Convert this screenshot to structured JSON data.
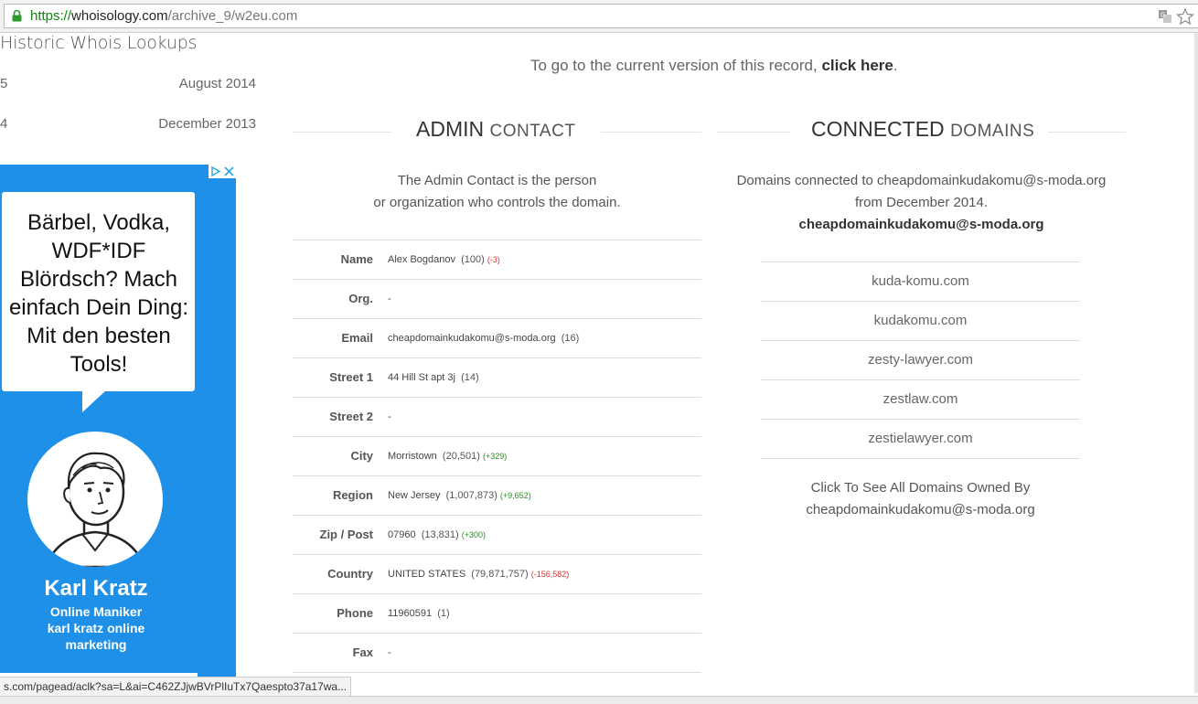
{
  "browser": {
    "url_scheme": "https://",
    "url_host": "whoisology.com",
    "url_path": "/archive_9/w2eu.com",
    "status_url": "s.com/pagead/aclk?sa=L&ai=C462ZJjwBVrPlIuTx7Qaespto37a17wa..."
  },
  "sidebar": {
    "title": "Historic Whois Lookups",
    "history": [
      {
        "num": "5",
        "date": "August 2014"
      },
      {
        "num": "4",
        "date": "December 2013"
      }
    ]
  },
  "ad": {
    "bubble_text": "Bärbel, Vodka, WDF*IDF Blördsch? Mach einfach Dein Ding: Mit den besten Tools!",
    "name": "Karl Kratz",
    "sub1": "Online Maniker",
    "sub2": "karl kratz online marketing",
    "bg_color": "#1e90e8"
  },
  "main": {
    "current_text": "To go to the current version of this record, ",
    "current_link": "click here",
    "current_tail": ".",
    "admin": {
      "title_bold": "ADMIN",
      "title_light": "CONTACT",
      "desc_line1": "The Admin Contact is the person",
      "desc_line2": "or organization who controls the domain.",
      "rows": [
        {
          "label": "Name",
          "value": "Alex Bogdanov",
          "count": "(100)",
          "delta": "(-3)",
          "delta_type": "neg"
        },
        {
          "label": "Org.",
          "value": "-",
          "count": "",
          "delta": "",
          "delta_type": ""
        },
        {
          "label": "Email",
          "value": "cheapdomainkudakomu@s-moda.org",
          "count": "(16)",
          "delta": "",
          "delta_type": ""
        },
        {
          "label": "Street 1",
          "value": "44 Hill St apt 3j",
          "count": "(14)",
          "delta": "",
          "delta_type": ""
        },
        {
          "label": "Street 2",
          "value": "-",
          "count": "",
          "delta": "",
          "delta_type": ""
        },
        {
          "label": "City",
          "value": "Morristown",
          "count": "(20,501)",
          "delta": "(+329)",
          "delta_type": "pos"
        },
        {
          "label": "Region",
          "value": "New Jersey",
          "count": "(1,007,873)",
          "delta": "(+9,652)",
          "delta_type": "pos"
        },
        {
          "label": "Zip / Post",
          "value": "07960",
          "count": "(13,831)",
          "delta": "(+300)",
          "delta_type": "pos"
        },
        {
          "label": "Country",
          "value": "UNITED STATES",
          "count": "(79,871,757)",
          "delta": "(-156,582)",
          "delta_type": "neg"
        },
        {
          "label": "Phone",
          "value": "11960591",
          "count": "(1)",
          "delta": "",
          "delta_type": ""
        },
        {
          "label": "Fax",
          "value": "-",
          "count": "",
          "delta": "",
          "delta_type": ""
        }
      ]
    },
    "connected": {
      "title_bold": "CONNECTED",
      "title_light": "DOMAINS",
      "desc_line1": "Domains connected to cheapdomainkudakomu@s-moda.org",
      "desc_line2": "from December 2014.",
      "desc_email": "cheapdomainkudakomu@s-moda.org",
      "domains": [
        "kuda-komu.com",
        "kudakomu.com",
        "zesty-lawyer.com",
        "zestlaw.com",
        "zestielawyer.com"
      ],
      "see_all_line1": "Click To See All Domains Owned By",
      "see_all_line2": "cheapdomainkudakomu@s-moda.org"
    }
  }
}
